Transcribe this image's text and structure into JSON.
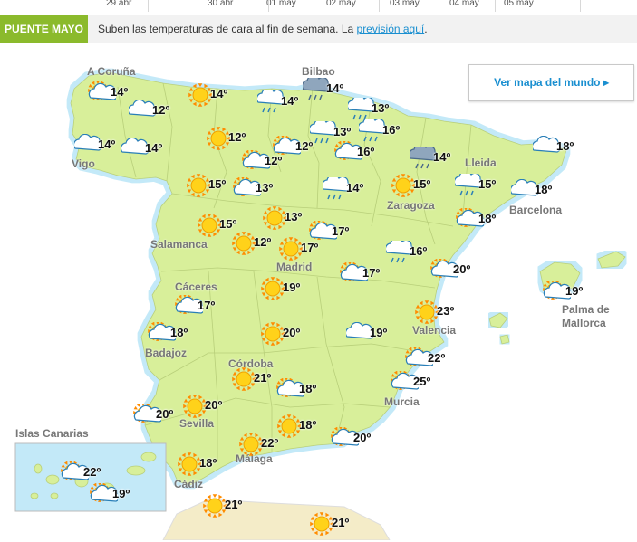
{
  "timeline": {
    "dates": [
      "29 abr",
      "30 abr",
      "01 may",
      "02 may",
      "03 may",
      "04 may",
      "05 may"
    ]
  },
  "banner": {
    "badge": "PUENTE MAYO",
    "text": "Suben las temperaturas de cara al fin de semana. La ",
    "link": "previsión aquí",
    "end": "."
  },
  "world_button": {
    "label": "Ver mapa del mundo ▸"
  },
  "colors": {
    "land": "#d8ef9a",
    "sea": "#c3e9f8",
    "badge": "#8bba2c",
    "link": "#1a8fd0"
  },
  "cities": {
    "acoruna": "A Coruña",
    "vigo": "Vigo",
    "bilbao": "Bilbao",
    "lleida": "Lleida",
    "barcelona": "Barcelona",
    "zaragoza": "Zaragoza",
    "salamanca": "Salamanca",
    "madrid": "Madrid",
    "caceres": "Cáceres",
    "badajoz": "Badajoz",
    "valencia": "Valencia",
    "palma": "Palma de",
    "palma2": "Mallorca",
    "cordoba": "Córdoba",
    "sevilla": "Sevilla",
    "murcia": "Murcia",
    "malaga": "Málaga",
    "cadiz": "Cádiz"
  },
  "canarias": {
    "title": "Islas Canarias"
  },
  "forecast": [
    {
      "icon": "sun-cloud-icon",
      "temp": "14º"
    },
    {
      "icon": "sun-icon-partial",
      "temp": "14º"
    },
    {
      "icon": "rain-cloud-icon",
      "temp": "14º"
    },
    {
      "icon": "storm-cloud-icon",
      "temp": "14º"
    },
    {
      "icon": "rain-cloud-icon",
      "temp": "13º"
    },
    {
      "icon": "cloud-icon",
      "temp": "12º"
    },
    {
      "icon": "sun-icon",
      "temp": "12º"
    },
    {
      "icon": "cloud-icon",
      "temp": "14º"
    },
    {
      "icon": "cloud-icon",
      "temp": "14º"
    },
    {
      "icon": "sun-cloud-icon",
      "temp": "12º"
    },
    {
      "icon": "sun-cloud-icon",
      "temp": "12º"
    },
    {
      "icon": "rain-cloud-icon",
      "temp": "13º"
    },
    {
      "icon": "rain-cloud-icon",
      "temp": "16º"
    },
    {
      "icon": "sun-cloud-icon",
      "temp": "16º"
    },
    {
      "icon": "storm-cloud-icon",
      "temp": "14º"
    },
    {
      "icon": "cloud-icon",
      "temp": "18º"
    },
    {
      "icon": "sun-icon",
      "temp": "15º"
    },
    {
      "icon": "sun-cloud-icon",
      "temp": "13º"
    },
    {
      "icon": "rain-cloud-icon",
      "temp": "14º"
    },
    {
      "icon": "sun-icon",
      "temp": "15º"
    },
    {
      "icon": "rain-cloud-icon",
      "temp": "15º"
    },
    {
      "icon": "cloud-icon",
      "temp": "18º"
    },
    {
      "icon": "sun-icon",
      "temp": "15º"
    },
    {
      "icon": "sun-icon",
      "temp": "13º"
    },
    {
      "icon": "sun-cloud-icon",
      "temp": "17º"
    },
    {
      "icon": "sun-cloud-icon",
      "temp": "18º"
    },
    {
      "icon": "sun-icon",
      "temp": "12º"
    },
    {
      "icon": "sun-icon",
      "temp": "17º"
    },
    {
      "icon": "rain-cloud-icon",
      "temp": "16º"
    },
    {
      "icon": "sun-cloud-icon",
      "temp": "20º"
    },
    {
      "icon": "sun-cloud-icon",
      "temp": "17º"
    },
    {
      "icon": "sun-cloud-icon",
      "temp": "17º"
    },
    {
      "icon": "sun-icon",
      "temp": "19º"
    },
    {
      "icon": "sun-cloud-icon",
      "temp": "19º"
    },
    {
      "icon": "sun-cloud-icon",
      "temp": "18º"
    },
    {
      "icon": "sun-icon",
      "temp": "23º"
    },
    {
      "icon": "sun-icon",
      "temp": "20º"
    },
    {
      "icon": "cloud-icon",
      "temp": "19º"
    },
    {
      "icon": "sun-cloud-icon",
      "temp": "22º"
    },
    {
      "icon": "sun-icon",
      "temp": "21º"
    },
    {
      "icon": "sun-cloud-icon",
      "temp": "18º"
    },
    {
      "icon": "sun-cloud-icon",
      "temp": "25º"
    },
    {
      "icon": "sun-cloud-icon",
      "temp": "20º"
    },
    {
      "icon": "sun-icon",
      "temp": "20º"
    },
    {
      "icon": "sun-icon",
      "temp": "18º"
    },
    {
      "icon": "sun-icon",
      "temp": "22º"
    },
    {
      "icon": "sun-cloud-icon",
      "temp": "20º"
    },
    {
      "icon": "sun-icon",
      "temp": "18º"
    },
    {
      "icon": "sun-cloud-icon",
      "temp": "22º"
    },
    {
      "icon": "sun-cloud-icon",
      "temp": "19º"
    },
    {
      "icon": "sun-icon",
      "temp": "21º"
    },
    {
      "icon": "sun-icon",
      "temp": "21º"
    }
  ]
}
